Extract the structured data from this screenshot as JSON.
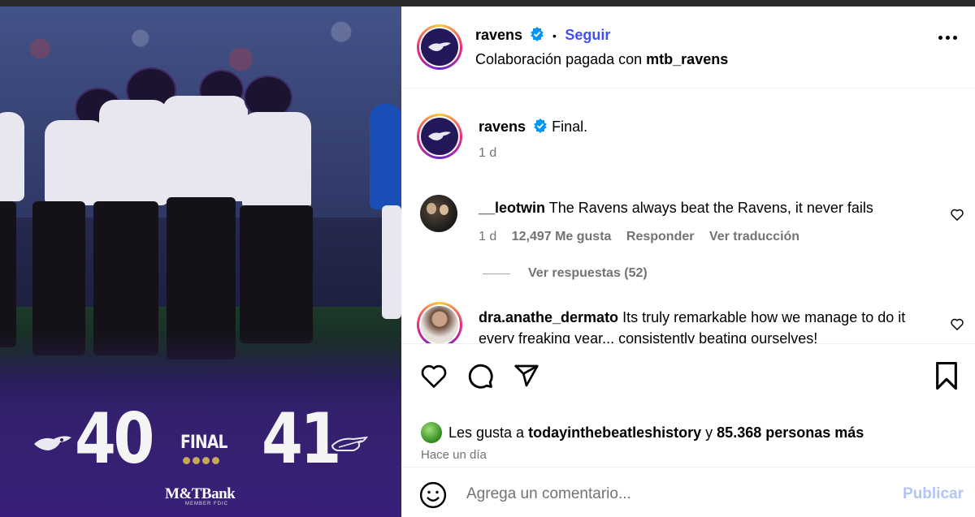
{
  "media": {
    "home_score": "40",
    "away_score": "41",
    "status": "FINAL",
    "sponsor": "M&TBank",
    "sponsor_sub": "MEMBER FDIC"
  },
  "header": {
    "username": "ravens",
    "separator": "•",
    "follow_label": "Seguir",
    "collab_prefix": "Colaboración pagada con",
    "collab_account": "mtb_ravens"
  },
  "caption": {
    "username": "ravens",
    "text": "Final.",
    "time": "1 d"
  },
  "comments": [
    {
      "username": "__leotwin",
      "text": "The Ravens always beat the Ravens, it never fails",
      "time": "1 d",
      "likes": "12,497 Me gusta",
      "reply": "Responder",
      "translate": "Ver traducción",
      "view_replies": "Ver respuestas (52)"
    },
    {
      "username": "dra.anathe_dermato",
      "text": "Its truly remarkable how we manage to do it every freaking year... consistently beating ourselves!"
    }
  ],
  "likes": {
    "prefix": "Les gusta a",
    "account": "todayinthebeatleshistory",
    "connector": "y",
    "others": "85.368 personas más"
  },
  "posted": "Hace un día",
  "add_comment": {
    "placeholder": "Agrega un comentario...",
    "publish_label": "Publicar"
  },
  "colors": {
    "follow": "#4150f7",
    "publish": "#b3c5f7",
    "secondary_text": "#737373"
  }
}
